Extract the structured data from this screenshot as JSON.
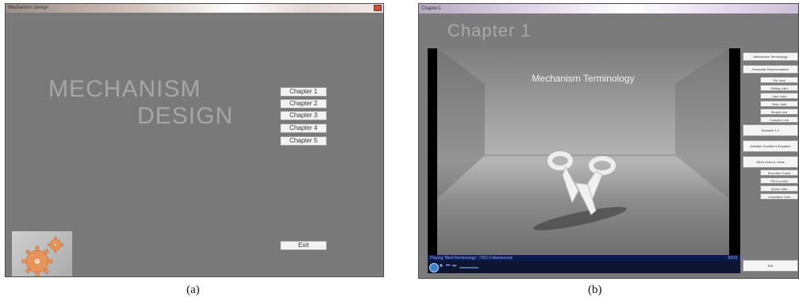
{
  "panel_a": {
    "window_title": "Mechanism Design",
    "heading_line1": "MECHANISM",
    "heading_line2": "DESIGN",
    "chapters": [
      "Chapter 1",
      "Chapter 2",
      "Chapter 3",
      "Chapter 4",
      "Chapter 5"
    ],
    "exit_label": "Exit",
    "label": "(a)"
  },
  "panel_b": {
    "window_title": "Chapter1",
    "title": "Chapter 1",
    "video_caption": "Mechanism Terminology",
    "status_text": "Playing 'MechTerminology': 7262.5 bits/second",
    "status_time": "00:01",
    "menu": {
      "mechanism_terminology": "Mechanism Terminology",
      "kinematic_representation": "Kinematic Representation",
      "pin_joint": "Pin Joint",
      "sliding_joint": "Sliding Joint",
      "cam_joint": "Cam Joint",
      "gear_joint": "Gear Joint",
      "simple_link": "Simple Link",
      "complex_link": "Complex Link",
      "example": "Example 1-1",
      "mobility": "Mobility/ Gruebler's Equation",
      "other_links": "Other Links & Joints",
      "eccentric_crank": "Eccentric Crank",
      "pin_in_slot": "Pin-in-a-slot",
      "screw_joint": "Screw Joint",
      "coincident_joint": "Coincident Joint"
    },
    "exit_label": "Exit",
    "label": "(b)"
  }
}
